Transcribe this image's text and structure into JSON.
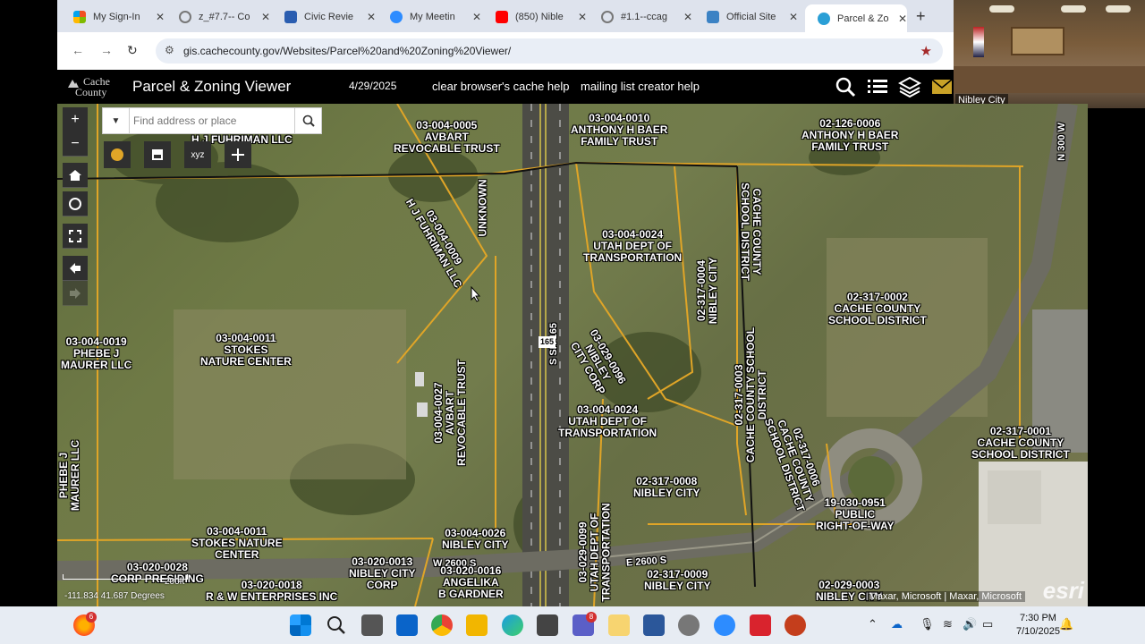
{
  "browser": {
    "tabs": [
      {
        "title": "My Sign-In",
        "color": "#f25022"
      },
      {
        "title": "z_#7.7-- Co",
        "color": "#777777"
      },
      {
        "title": "Civic Revie",
        "color": "#2a5db0"
      },
      {
        "title": "My Meetin",
        "color": "#2d8cff"
      },
      {
        "title": "(850) Nible",
        "color": "#ff0000"
      },
      {
        "title": "#1.1--ccag",
        "color": "#777777"
      },
      {
        "title": "Official Site",
        "color": "#3b82c4"
      },
      {
        "title": "Parcel & Zo",
        "color": "#2a9fd6"
      }
    ],
    "url": "gis.cachecounty.gov/Websites/Parcel%20and%20Zoning%20Viewer/"
  },
  "webcam": {
    "label": "Nibley City"
  },
  "app": {
    "logo_line1": "Cache",
    "logo_line2": "County",
    "title": "Parcel & Zoning Viewer",
    "date": "4/29/2025",
    "link1": "clear browser's cache help",
    "link2": "mailing list creator help"
  },
  "map": {
    "search_placeholder": "Find address or place",
    "tools": [
      "xyz"
    ],
    "coords": "-111.834 41.687 Degrees",
    "scale": "200ft",
    "attribution": "Maxar, Microsoft | Maxar, Microsoft",
    "powered": "esri",
    "roads": [
      "S SR 165",
      "E 2600 S",
      "W 2600 S",
      "N 300 W",
      "165"
    ],
    "parcels": [
      {
        "id": "03-004-0005",
        "owner1": "AVBART",
        "owner2": "REVOCABLE TRUST"
      },
      {
        "id": "03-004-0010",
        "owner1": "ANTHONY H BAER",
        "owner2": "FAMILY TRUST"
      },
      {
        "id": "02-126-0006",
        "owner1": "ANTHONY H BAER",
        "owner2": "FAMILY TRUST"
      },
      {
        "id": "03-004-0001",
        "owner1": "H J FUHRIMAN LLC",
        "owner2": ""
      },
      {
        "id": "03-004-0009",
        "owner1": "H J FUHRIMAN LLC",
        "owner2": ""
      },
      {
        "id": "UNKNOWN",
        "owner1": "",
        "owner2": ""
      },
      {
        "id": "03-004-0024",
        "owner1": "UTAH DEPT OF",
        "owner2": "TRANSPORTATION"
      },
      {
        "id": "02-317-0004",
        "owner1": "NIBLEY CITY",
        "owner2": ""
      },
      {
        "id": "02-317-0005",
        "owner1": "CACHE COUNTY",
        "owner2": "SCHOOL DISTRICT"
      },
      {
        "id": "02-317-0002",
        "owner1": "CACHE COUNTY",
        "owner2": "SCHOOL DISTRICT"
      },
      {
        "id": "03-004-0019",
        "owner1": "PHEBE J",
        "owner2": "MAURER LLC"
      },
      {
        "id": "03-004-0011",
        "owner1": "STOKES",
        "owner2": "NATURE CENTER"
      },
      {
        "id": "03-029-0096",
        "owner1": "NIBLEY",
        "owner2": "CITY CORP"
      },
      {
        "id": "03-004-0027",
        "owner1": "AVBART",
        "owner2": "REVOCABLE TRUST"
      },
      {
        "id": "02-317-0003",
        "owner1": "CACHE COUNTY SCHOOL",
        "owner2": "DISTRICT"
      },
      {
        "id": "02-317-0006",
        "owner1": "CACHE COUNTY",
        "owner2": "SCHOOL DISTRICT"
      },
      {
        "id": "03-004-0024",
        "owner1": "UTAH DEPT OF",
        "owner2": "TRANSPORTATION"
      },
      {
        "id": "02-317-0001",
        "owner1": "CACHE COUNTY",
        "owner2": "SCHOOL DISTRICT"
      },
      {
        "id": "03-004-0015",
        "owner1": "PHEBE J",
        "owner2": "MAURER LLC"
      },
      {
        "id": "02-317-0008",
        "owner1": "NIBLEY CITY",
        "owner2": ""
      },
      {
        "id": "19-030-0951",
        "owner1": "PUBLIC",
        "owner2": "RIGHT-OF-WAY"
      },
      {
        "id": "03-004-0011",
        "owner1": "STOKES NATURE",
        "owner2": "CENTER"
      },
      {
        "id": "03-004-0026",
        "owner1": "NIBLEY CITY",
        "owner2": ""
      },
      {
        "id": "03-029-0099",
        "owner1": "UTAH DEPT OF",
        "owner2": "TRANSPORTATION"
      },
      {
        "id": "03-020-0028",
        "owner1": "CORP PRESIDING",
        "owner2": "BISHOP OF THE"
      },
      {
        "id": "03-020-0013",
        "owner1": "NIBLEY CITY",
        "owner2": "CORP"
      },
      {
        "id": "03-020-0016",
        "owner1": "ANGELIKA",
        "owner2": "B GARDNER"
      },
      {
        "id": "03-020-0018",
        "owner1": "R & W ENTERPRISES INC",
        "owner2": ""
      },
      {
        "id": "02-317-0009",
        "owner1": "NIBLEY CITY",
        "owner2": ""
      },
      {
        "id": "02-029-0003",
        "owner1": "NIBLEY CITY",
        "owner2": ""
      }
    ]
  },
  "taskbar": {
    "time": "7:30 PM",
    "date": "7/10/2025",
    "badge_firefox": "6",
    "badge_teams": "8"
  }
}
